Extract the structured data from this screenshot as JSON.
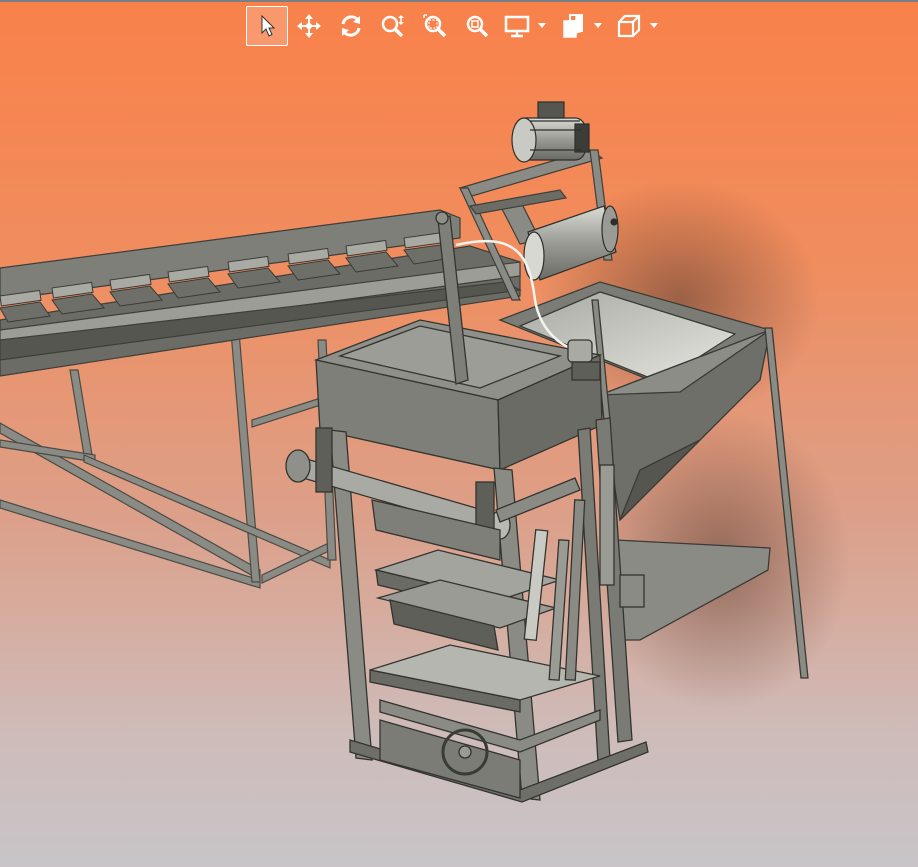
{
  "app": {
    "view": "3d-cad-viewport",
    "background_top": "#f9814a",
    "background_bottom": "#c8c4c8"
  },
  "toolbar": {
    "buttons": [
      {
        "id": "select",
        "icon": "pointer-arrow-icon",
        "active": true,
        "dropdown": false
      },
      {
        "id": "pan",
        "icon": "move-arrows-icon",
        "active": false,
        "dropdown": false
      },
      {
        "id": "rotate",
        "icon": "rotate-icon",
        "active": false,
        "dropdown": false
      },
      {
        "id": "zoom",
        "icon": "zoom-in-out-icon",
        "active": false,
        "dropdown": false
      },
      {
        "id": "zoom-window",
        "icon": "zoom-window-icon",
        "active": false,
        "dropdown": false
      },
      {
        "id": "zoom-fit",
        "icon": "zoom-fit-icon",
        "active": false,
        "dropdown": false
      },
      {
        "id": "display-mode",
        "icon": "monitor-icon",
        "active": false,
        "dropdown": true
      },
      {
        "id": "section-view",
        "icon": "section-view-icon",
        "active": false,
        "dropdown": true
      },
      {
        "id": "standard-views",
        "icon": "cube-view-icon",
        "active": false,
        "dropdown": true
      }
    ],
    "icon_color": "#ffffff"
  },
  "model": {
    "name_icon": "block-making-machine-model",
    "parts": [
      "belt-conveyor",
      "motor",
      "drive-drum",
      "hopper",
      "press-frame",
      "hydraulic-cylinders",
      "mold-box",
      "pallet-tray"
    ],
    "metal_color": "#8a8b84",
    "metal_dark": "#55564f",
    "metal_light": "#b9bab2"
  }
}
